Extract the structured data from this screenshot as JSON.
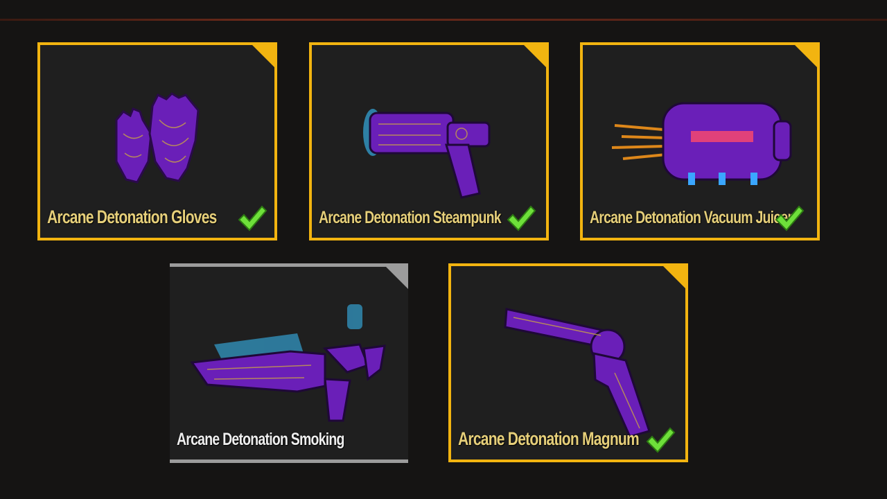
{
  "items": [
    {
      "name": "Arcane Detonation Gloves",
      "owned": true,
      "frame": "gold",
      "icon": "gloves-icon"
    },
    {
      "name": "Arcane Detonation Steampunk",
      "owned": true,
      "frame": "gold",
      "icon": "steampunk-gun-icon"
    },
    {
      "name": "Arcane Detonation Vacuum Juicer",
      "owned": true,
      "frame": "gold",
      "icon": "vacuum-juicer-icon"
    },
    {
      "name": "Arcane Detonation Smoking",
      "owned": false,
      "frame": "grey",
      "icon": "smoking-gun-icon"
    },
    {
      "name": "Arcane Detonation Magnum",
      "owned": true,
      "frame": "gold",
      "icon": "magnum-revolver-icon"
    }
  ],
  "colors": {
    "gold_frame": "#f2b410",
    "grey_frame": "#9c9c9c",
    "check": "#6ee03a",
    "item_purple": "#7a1fd6"
  }
}
